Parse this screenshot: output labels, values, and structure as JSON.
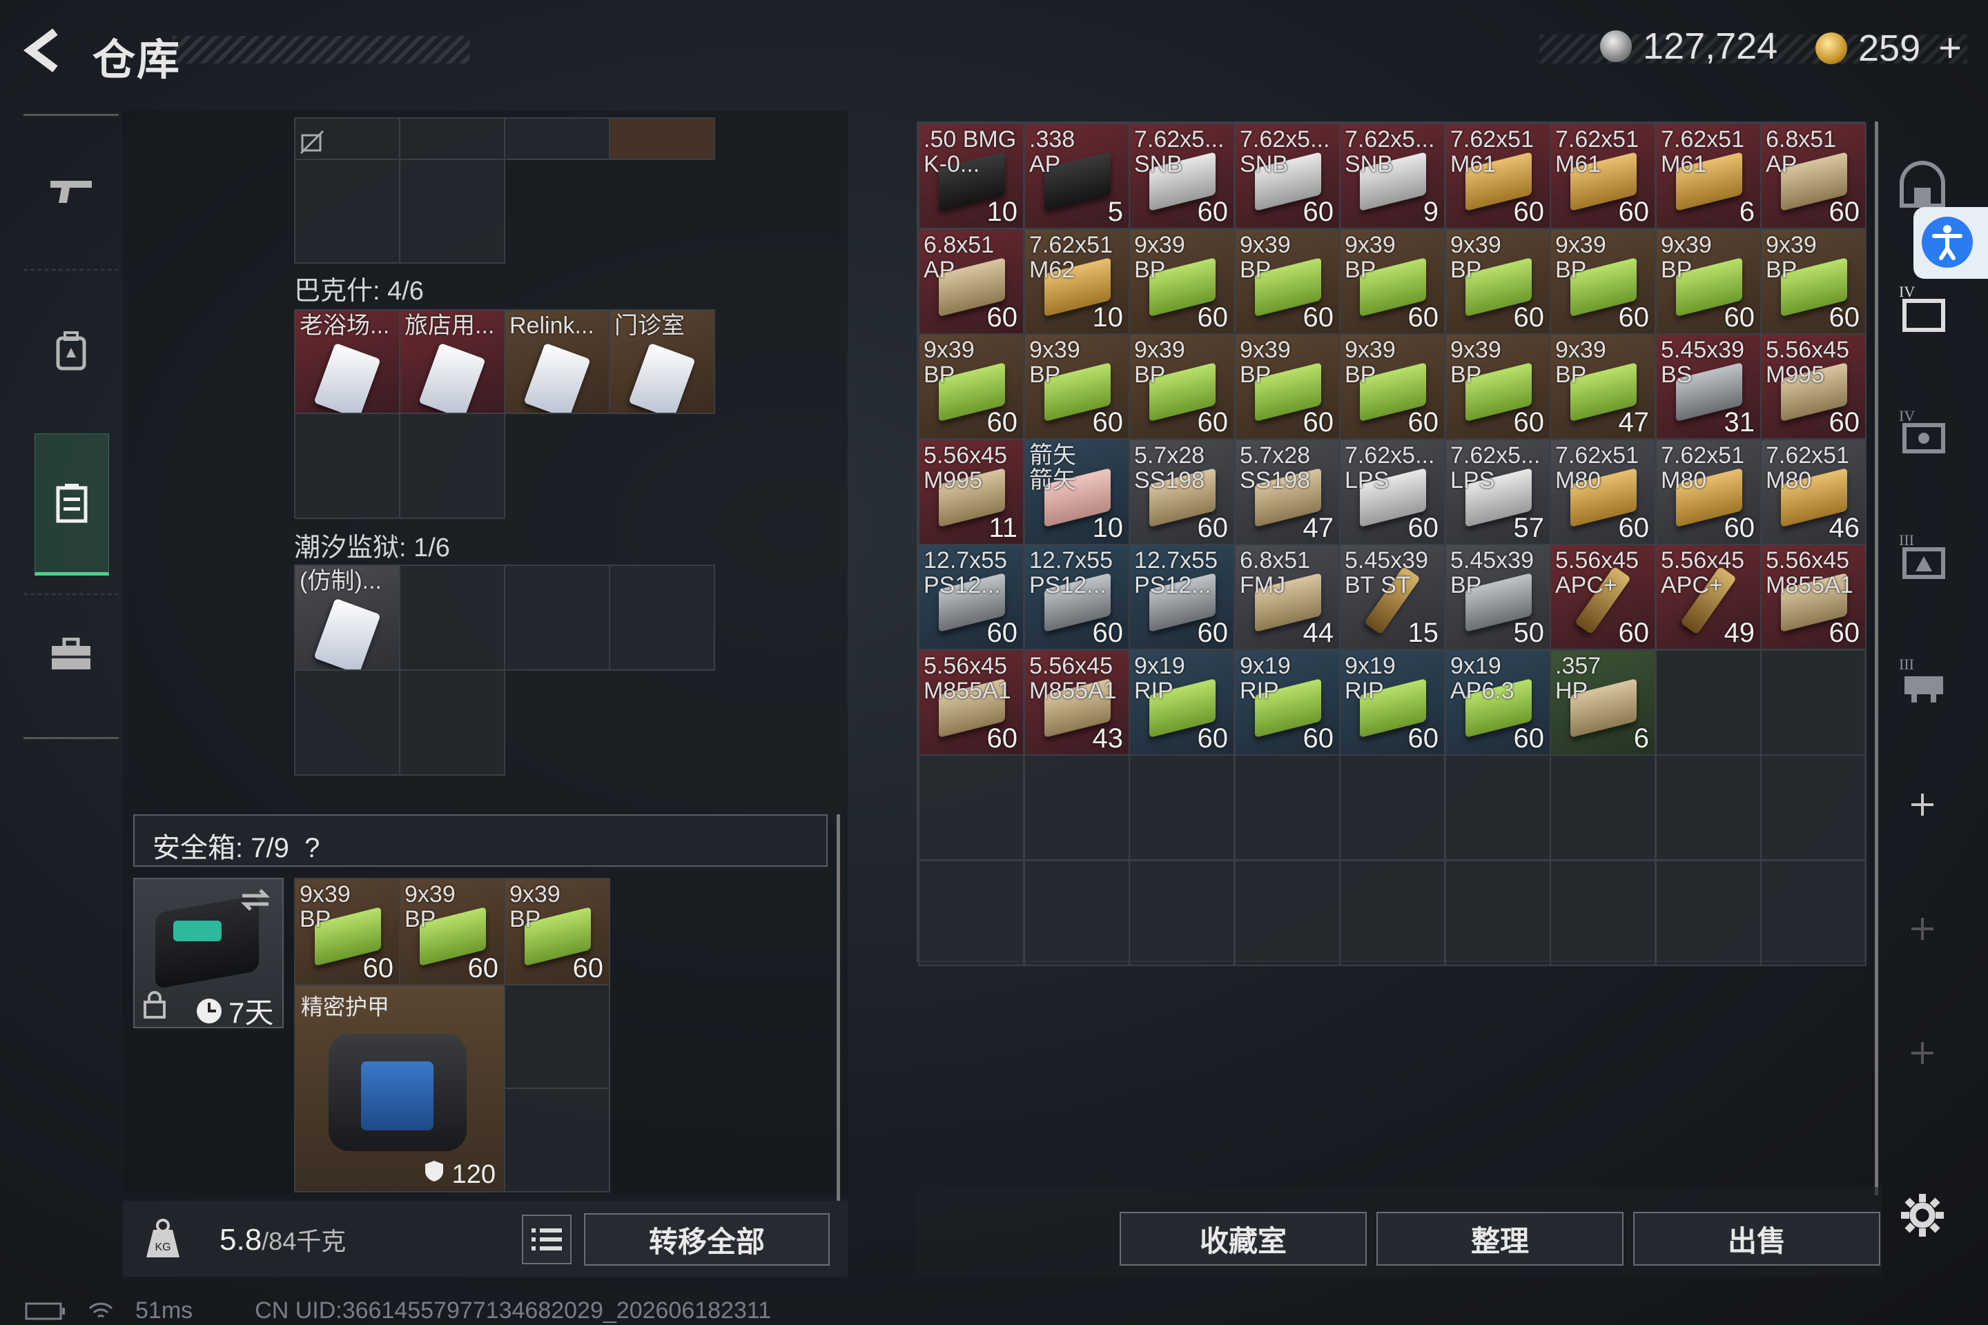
{
  "header": {
    "title": "仓库",
    "silver": "127,724",
    "gold": "259",
    "plus": "+"
  },
  "sections": {
    "bakshi": "巴克什: 4/6",
    "prison": "潮汐监狱: 1/6",
    "safe": "安全箱: 7/9",
    "help": "?"
  },
  "top_row": [
    "",
    "",
    "",
    ""
  ],
  "bakshi_items": [
    {
      "label": "老浴场...",
      "rarity": "r-red"
    },
    {
      "label": "旅店用...",
      "rarity": "r-red"
    },
    {
      "label": "Relink...",
      "rarity": "r-brown"
    },
    {
      "label": "门诊室",
      "rarity": "r-brown"
    }
  ],
  "prison_items": [
    {
      "label": "(仿制)...",
      "rarity": "r-gray"
    }
  ],
  "safe_items": [
    {
      "label": "9x39\nBP",
      "count": "60",
      "box": "b-green",
      "rarity": "r-brown"
    },
    {
      "label": "9x39\nBP",
      "count": "60",
      "box": "b-green",
      "rarity": "r-brown"
    },
    {
      "label": "9x39\nBP",
      "count": "60",
      "box": "b-green",
      "rarity": "r-brown"
    }
  ],
  "safe_case": {
    "days": "7天"
  },
  "armor": {
    "label": "精密护甲",
    "durability": "120"
  },
  "weight": {
    "current": "5.8",
    "max": "/84千克"
  },
  "buttons": {
    "transfer_all": "转移全部",
    "collection": "收藏室",
    "organize": "整理",
    "sell": "出售"
  },
  "status": {
    "ping": "51ms",
    "uid": "CN UID:36614557977134682029_202606182311"
  },
  "stash_items": [
    {
      "label": ".50 BMG\nK-0...",
      "count": "10",
      "box": "b-dark",
      "rarity": "r-red"
    },
    {
      "label": ".338\nAP",
      "count": "5",
      "box": "b-dark",
      "rarity": "r-red"
    },
    {
      "label": "7.62x5...\nSNB",
      "count": "60",
      "box": "b-white",
      "rarity": "r-red"
    },
    {
      "label": "7.62x5...\nSNB",
      "count": "60",
      "box": "b-white",
      "rarity": "r-red"
    },
    {
      "label": "7.62x5...\nSNB",
      "count": "9",
      "box": "b-white",
      "rarity": "r-red"
    },
    {
      "label": "7.62x51\nM61",
      "count": "60",
      "box": "b-gold",
      "rarity": "r-red"
    },
    {
      "label": "7.62x51\nM61",
      "count": "60",
      "box": "b-gold",
      "rarity": "r-red"
    },
    {
      "label": "7.62x51\nM61",
      "count": "6",
      "box": "b-gold",
      "rarity": "r-red"
    },
    {
      "label": "6.8x51\nAP",
      "count": "60",
      "box": "b-tan",
      "rarity": "r-red"
    },
    {
      "label": "6.8x51\nAP",
      "count": "60",
      "box": "b-tan",
      "rarity": "r-red"
    },
    {
      "label": "7.62x51\nM62",
      "count": "10",
      "box": "b-gold",
      "rarity": "r-brown"
    },
    {
      "label": "9x39\nBP",
      "count": "60",
      "box": "b-green",
      "rarity": "r-brown"
    },
    {
      "label": "9x39\nBP",
      "count": "60",
      "box": "b-green",
      "rarity": "r-brown"
    },
    {
      "label": "9x39\nBP",
      "count": "60",
      "box": "b-green",
      "rarity": "r-brown"
    },
    {
      "label": "9x39\nBP",
      "count": "60",
      "box": "b-green",
      "rarity": "r-brown"
    },
    {
      "label": "9x39\nBP",
      "count": "60",
      "box": "b-green",
      "rarity": "r-brown"
    },
    {
      "label": "9x39\nBP",
      "count": "60",
      "box": "b-green",
      "rarity": "r-brown"
    },
    {
      "label": "9x39\nBP",
      "count": "60",
      "box": "b-green",
      "rarity": "r-brown"
    },
    {
      "label": "9x39\nBP",
      "count": "60",
      "box": "b-green",
      "rarity": "r-brown"
    },
    {
      "label": "9x39\nBP",
      "count": "60",
      "box": "b-green",
      "rarity": "r-brown"
    },
    {
      "label": "9x39\nBP",
      "count": "60",
      "box": "b-green",
      "rarity": "r-brown"
    },
    {
      "label": "9x39\nBP",
      "count": "60",
      "box": "b-green",
      "rarity": "r-brown"
    },
    {
      "label": "9x39\nBP",
      "count": "60",
      "box": "b-green",
      "rarity": "r-brown"
    },
    {
      "label": "9x39\nBP",
      "count": "60",
      "box": "b-green",
      "rarity": "r-brown"
    },
    {
      "label": "9x39\nBP",
      "count": "47",
      "box": "b-green",
      "rarity": "r-brown"
    },
    {
      "label": "5.45x39\nBS",
      "count": "31",
      "box": "b-steel",
      "rarity": "r-red"
    },
    {
      "label": "5.56x45\nM995",
      "count": "60",
      "box": "b-tan",
      "rarity": "r-red"
    },
    {
      "label": "5.56x45\nM995",
      "count": "11",
      "box": "b-tan",
      "rarity": "r-red"
    },
    {
      "label": "箭矢\n箭矢",
      "count": "10",
      "box": "b-pink",
      "rarity": "r-blue"
    },
    {
      "label": "5.7x28\nSS198",
      "count": "60",
      "box": "b-tan",
      "rarity": "r-gray"
    },
    {
      "label": "5.7x28\nSS198",
      "count": "47",
      "box": "b-tan",
      "rarity": "r-gray"
    },
    {
      "label": "7.62x5...\nLPS",
      "count": "60",
      "box": "b-white",
      "rarity": "r-gray"
    },
    {
      "label": "7.62x5...\nLPS",
      "count": "57",
      "box": "b-white",
      "rarity": "r-gray"
    },
    {
      "label": "7.62x51\nM80",
      "count": "60",
      "box": "b-gold",
      "rarity": "r-gray"
    },
    {
      "label": "7.62x51\nM80",
      "count": "60",
      "box": "b-gold",
      "rarity": "r-gray"
    },
    {
      "label": "7.62x51\nM80",
      "count": "46",
      "box": "b-gold",
      "rarity": "r-gray"
    },
    {
      "label": "12.7x55\nPS12...",
      "count": "60",
      "box": "b-steel",
      "rarity": "r-blue"
    },
    {
      "label": "12.7x55\nPS12...",
      "count": "60",
      "box": "b-steel",
      "rarity": "r-blue"
    },
    {
      "label": "12.7x55\nPS12...",
      "count": "60",
      "box": "b-steel",
      "rarity": "r-blue"
    },
    {
      "label": "6.8x51\nFMJ",
      "count": "44",
      "box": "b-tan",
      "rarity": "r-gray"
    },
    {
      "label": "5.45x39\nBT ST",
      "count": "15",
      "box": "b-brass",
      "rarity": "r-gray"
    },
    {
      "label": "5.45x39\nBP",
      "count": "50",
      "box": "b-steel",
      "rarity": "r-gray"
    },
    {
      "label": "5.56x45\nAPC+",
      "count": "60",
      "box": "b-brass",
      "rarity": "r-red"
    },
    {
      "label": "5.56x45\nAPC+",
      "count": "49",
      "box": "b-brass",
      "rarity": "r-red"
    },
    {
      "label": "5.56x45\nM855A1",
      "count": "60",
      "box": "b-tan",
      "rarity": "r-red"
    },
    {
      "label": "5.56x45\nM855A1",
      "count": "60",
      "box": "b-tan",
      "rarity": "r-red"
    },
    {
      "label": "5.56x45\nM855A1",
      "count": "43",
      "box": "b-tan",
      "rarity": "r-red"
    },
    {
      "label": "9x19\nRIP",
      "count": "60",
      "box": "b-green",
      "rarity": "r-blue"
    },
    {
      "label": "9x19\nRIP",
      "count": "60",
      "box": "b-green",
      "rarity": "r-blue"
    },
    {
      "label": "9x19\nRIP",
      "count": "60",
      "box": "b-green",
      "rarity": "r-blue"
    },
    {
      "label": "9x19\nAP6.3",
      "count": "60",
      "box": "b-green",
      "rarity": "r-blue"
    },
    {
      "label": ".357\nHP",
      "count": "6",
      "box": "b-tan",
      "rarity": "r-green"
    }
  ]
}
